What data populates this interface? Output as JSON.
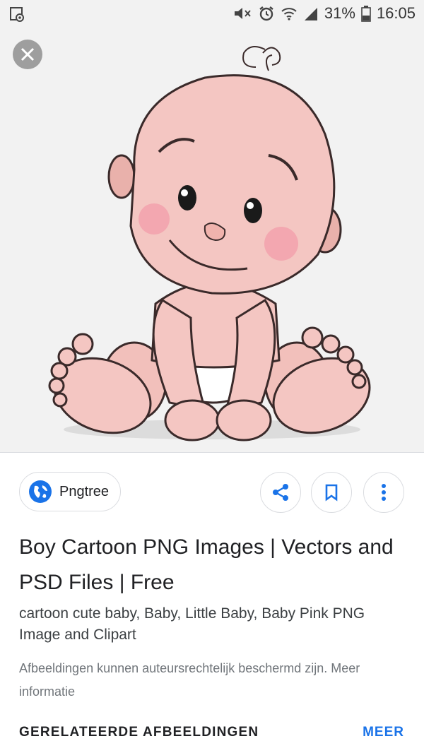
{
  "status_bar": {
    "battery_percent": "31%",
    "time": "16:05",
    "icons": [
      "screenshot-notification-icon",
      "mute-icon",
      "alarm-icon",
      "wifi-icon",
      "signal-icon",
      "battery-icon"
    ]
  },
  "viewer": {
    "close_icon": "close-icon",
    "image_subject": "cartoon-baby-image"
  },
  "source": {
    "name": "Pngtree",
    "icon": "globe-icon"
  },
  "actions": {
    "share_icon": "share-icon",
    "bookmark_icon": "bookmark-icon",
    "more_icon": "more-vert-icon"
  },
  "result": {
    "title": "Boy Cartoon PNG Images | Vectors and PSD Files | Free",
    "description": "cartoon cute baby, Baby, Little Baby, Baby Pink PNG Image and Clipart",
    "disclaimer": "Afbeeldingen kunnen auteursrechtelijk beschermd zijn. Meer informatie"
  },
  "related": {
    "header": "GERELATEERDE AFBEELDINGEN",
    "more_label": "MEER"
  },
  "colors": {
    "accent": "#1a73e8",
    "skin": "#f4c6c2",
    "cheek": "#f29aa8",
    "outline": "#3a2a2a"
  }
}
